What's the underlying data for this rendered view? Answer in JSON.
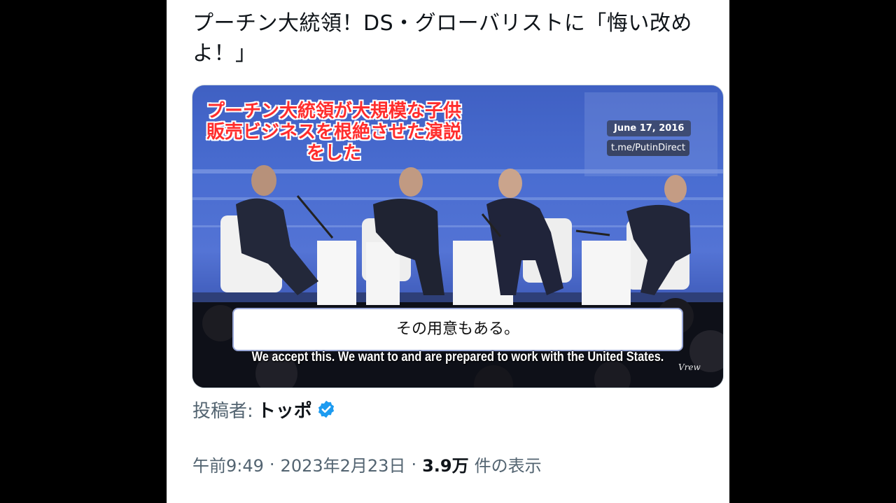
{
  "post": {
    "title": "プーチン大統領！DS・グローバリストに「悔い改めよ！」",
    "author_label": "投稿者:",
    "author_name": "トッポ",
    "verified_icon": "verified-badge-icon",
    "time": "午前9:49",
    "date": "2023年2月23日",
    "separator": "·",
    "view_count": "3.9万",
    "view_label": "件の表示"
  },
  "video": {
    "overlay_caption": "プーチン大統領が大規模な子供販売ビジネスを根絶させた演説をした",
    "date_stamp": "June 17, 2016",
    "channel_stamp": "t.me/PutinDirect",
    "subtitle_jp": "その用意もある。",
    "subtitle_en": "We accept this. We want to and are prepared to work with the United States.",
    "watermark": "Vrew"
  },
  "colors": {
    "verified": "#1d9bf0",
    "caption_red": "#ff2d2d",
    "muted_text": "#536471",
    "text": "#0f1419"
  }
}
